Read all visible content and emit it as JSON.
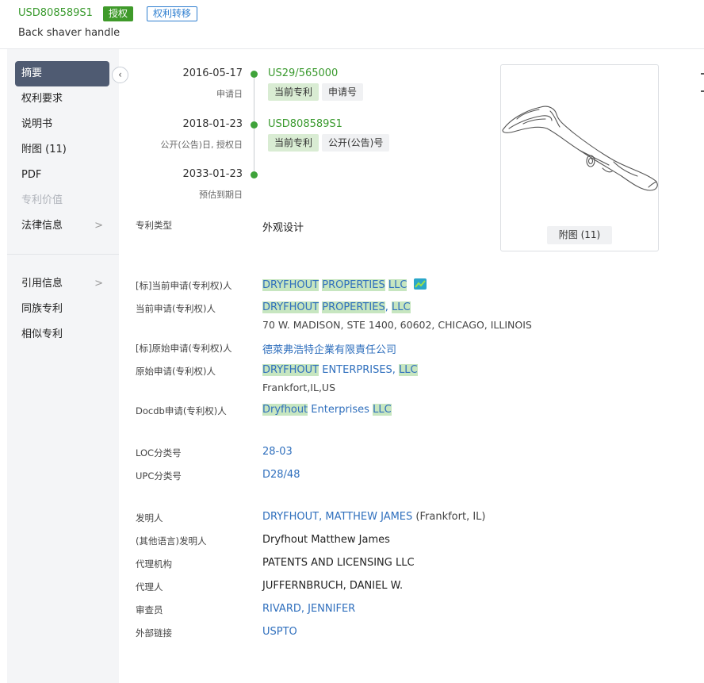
{
  "header": {
    "pub_number": "USD808589S1",
    "status_badge": "授权",
    "transfer_badge": "权利转移",
    "title": "Back shaver handle"
  },
  "sidebar": {
    "collapse_icon": "chevron-left-icon",
    "items": [
      {
        "label": "摘要",
        "state": "active"
      },
      {
        "label": "权利要求"
      },
      {
        "label": "说明书"
      },
      {
        "label": "附图 (11)"
      },
      {
        "label": "PDF"
      },
      {
        "label": "专利价值",
        "state": "disabled"
      },
      {
        "label": "法律信息",
        "expandable": true
      },
      {
        "label": "引用信息",
        "expandable": true
      },
      {
        "label": "同族专利"
      },
      {
        "label": "相似专利"
      }
    ]
  },
  "timeline": [
    {
      "date": "2016-05-17",
      "sub": "申请日",
      "number": "US29/565000",
      "tag1": "当前专利",
      "tag2": "申请号"
    },
    {
      "date": "2018-01-23",
      "sub": "公开(公告)日, 授权日",
      "number": "USD808589S1",
      "tag1": "当前专利",
      "tag2": "公开(公告)号"
    },
    {
      "date": "2033-01-23",
      "sub": "预估到期日"
    }
  ],
  "figure": {
    "caption": "附图 (11)"
  },
  "fields": {
    "patent_type": {
      "label": "专利类型",
      "value": "外观设计"
    },
    "std_current_assignee": {
      "label": "[标]当前申请(专利权)人",
      "parts": [
        "DRYFHOUT",
        "PROPERTIES",
        "LLC"
      ]
    },
    "current_assignee": {
      "label": "当前申请(专利权)人",
      "parts": [
        "DRYFHOUT",
        "PROPERTIES",
        "LLC"
      ],
      "address": "70 W. MADISON, STE 1400, 60602, CHICAGO, ILLINOIS"
    },
    "std_original_assignee": {
      "label": "[标]原始申请(专利权)人",
      "value": "德萊弗浩特企業有限責任公司"
    },
    "original_assignee": {
      "label": "原始申请(专利权)人",
      "parts": [
        "DRYFHOUT",
        "ENTERPRISES",
        "LLC"
      ],
      "address": "Frankfort,IL,US"
    },
    "docdb_assignee": {
      "label": "Docdb申请(专利权)人",
      "parts": [
        "Dryfhout",
        "Enterprises",
        "LLC"
      ]
    },
    "loc": {
      "label": "LOC分类号",
      "value": "28-03"
    },
    "upc": {
      "label": "UPC分类号",
      "value": "D28/48"
    },
    "inventor": {
      "label": "发明人",
      "value": "DRYFHOUT, MATTHEW JAMES",
      "suffix": "(Frankfort, IL)"
    },
    "inventor_other": {
      "label": "(其他语言)发明人",
      "value": "Dryfhout Matthew James"
    },
    "agency": {
      "label": "代理机构",
      "value": "PATENTS AND LICENSING LLC"
    },
    "agent": {
      "label": "代理人",
      "value": "JUFFERNBRUCH, DANIEL W."
    },
    "examiner": {
      "label": "审查员",
      "value": "RIVARD, JENNIFER"
    },
    "external_link": {
      "label": "外部链接",
      "value": "USPTO"
    }
  },
  "colors": {
    "accent_green": "#3a9a2e",
    "link_blue": "#2f6fbd",
    "highlight": "#c7e6c0",
    "nav_active": "#4f5b72"
  }
}
